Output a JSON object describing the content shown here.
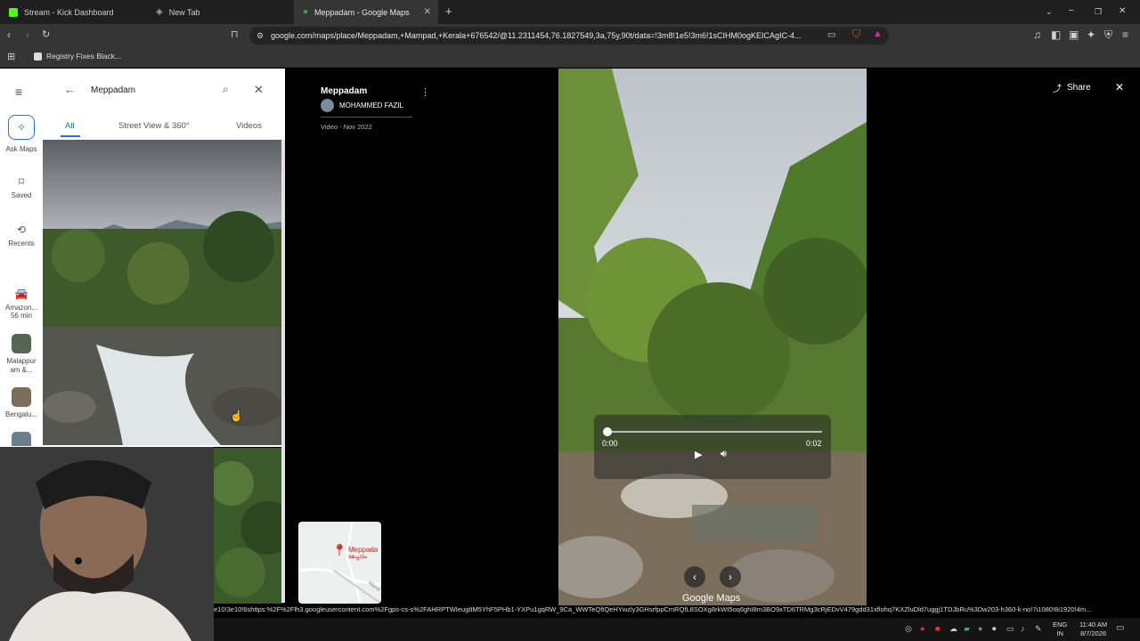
{
  "browser": {
    "tabs": [
      {
        "title": "Stream - Kick Dashboard",
        "favicon_color": "#53fc18",
        "active": false
      },
      {
        "title": "New Tab",
        "favicon_color": "#9a9a9a",
        "active": false
      },
      {
        "title": "Meppadam - Google Maps",
        "favicon_color": "#34a853",
        "active": true
      }
    ],
    "url": "google.com/maps/place/Meppadam,+Mampad,+Kerala+676542/@11.2311454,76.1827549,3a,75y,90t/data=!3m8!1e5!3m6!1sCIHM0ogKEICAgIC-4...",
    "bookmark": "Registry Fixes Black..."
  },
  "maps": {
    "rail": {
      "ask_maps": "Ask Maps",
      "saved": "Saved",
      "recents": "Recents",
      "recent_items": [
        {
          "label": "Amazon...",
          "sub": "56 min"
        },
        {
          "label": "Malappur am &..."
        },
        {
          "label": "Bengalu..."
        }
      ]
    },
    "search": {
      "value": "Meppadam"
    },
    "photo_tabs": [
      "All",
      "Street View & 360°",
      "Videos"
    ],
    "viewer": {
      "title": "Meppadam",
      "author": "MOHAMMED FAZIL",
      "meta": "Video - Nov 2022",
      "share": "Share",
      "time_current": "0:00",
      "time_total": "0:02",
      "progress": 0.0,
      "watermark": "Google Maps"
    },
    "minimap": {
      "label": "Meppada",
      "sub": "മേപ്പാടം",
      "road": "Wand"
    }
  },
  "status_url": "e10!3e10!6shttps:%2F%2Flh3.googleusercontent.com%2Fgps-cs-s%2FAHRPTWIeugtIM5YhF5PHb1-YXPu1gqRW_9Ca_WWTeQftQeHYwzly3GHsrfppCmRQfL8SOXg8rkWI5oq6ghI8m3BO9xTD6TRMg3cRjEDvV479gdd31xflohq7KXZluDld7uggj1TDJbRu%3Dw203-h360-k-no!7i1080!8i1920!4m...",
  "taskbar": {
    "lang": "ENG",
    "region": "IN",
    "time": "11:40 AM",
    "date": "8/7/2026"
  },
  "colors": {
    "accent": "#1a73e8",
    "tab_active_bg": "#353535",
    "tab_bar_bg": "#1f1f1f"
  }
}
